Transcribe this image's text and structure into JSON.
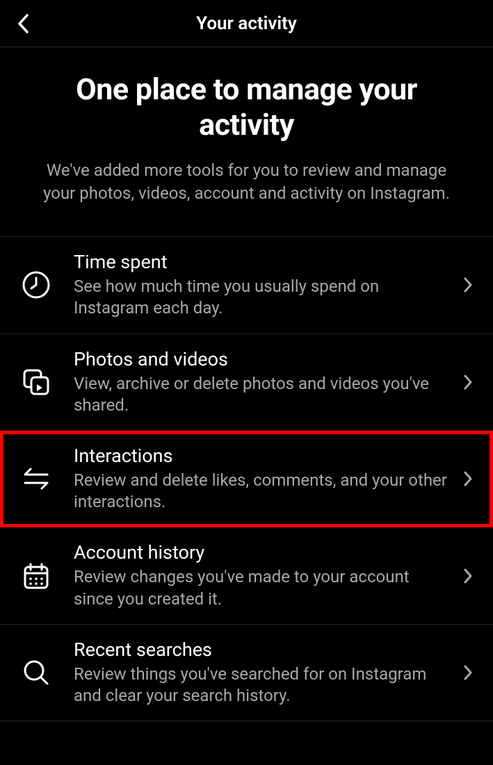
{
  "header": {
    "title": "Your activity"
  },
  "hero": {
    "title": "One place to manage your activity",
    "subtitle": "We've added more tools for you to review and manage your photos, videos, account and activity on Instagram."
  },
  "items": [
    {
      "icon": "clock",
      "title": "Time spent",
      "subtitle": "See how much time you usually spend on Instagram each day.",
      "highlighted": false
    },
    {
      "icon": "photos",
      "title": "Photos and videos",
      "subtitle": "View, archive or delete photos and videos you've shared.",
      "highlighted": false
    },
    {
      "icon": "arrows",
      "title": "Interactions",
      "subtitle": "Review and delete likes, comments, and your other interactions.",
      "highlighted": true
    },
    {
      "icon": "calendar",
      "title": "Account history",
      "subtitle": "Review changes you've made to your account since you created it.",
      "highlighted": false
    },
    {
      "icon": "search",
      "title": "Recent searches",
      "subtitle": "Review things you've searched for on Instagram and clear your search history.",
      "highlighted": false
    }
  ]
}
